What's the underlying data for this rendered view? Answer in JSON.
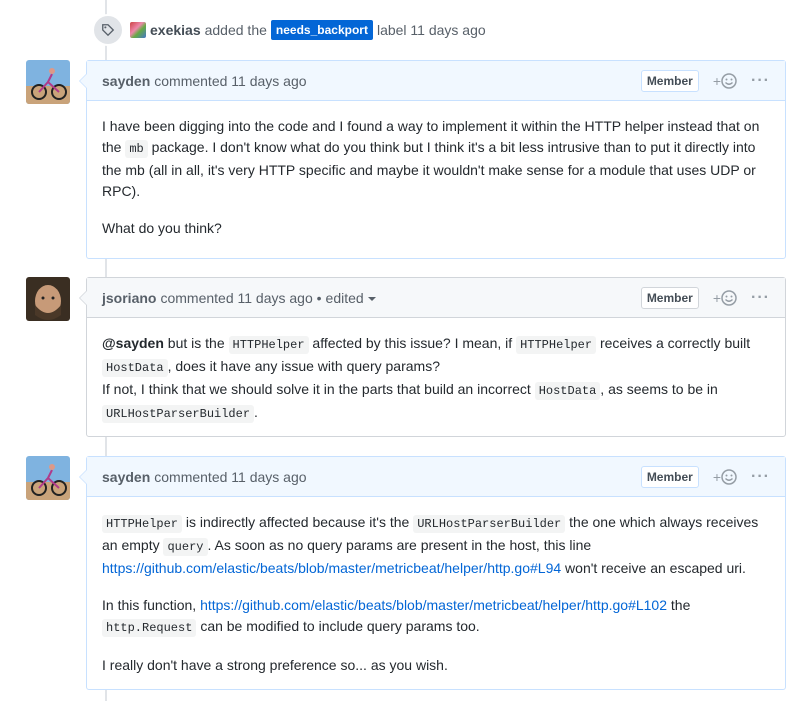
{
  "event": {
    "actor": "exekias",
    "text_before": "added the",
    "label": "needs_backport",
    "text_after": "label 11 days ago",
    "icon": "tag-icon"
  },
  "comments": [
    {
      "author": "sayden",
      "meta": "commented 11 days ago",
      "member": "Member",
      "react": "+",
      "body": {
        "p1_a": "I have been digging into the code and I found a way to implement it within the HTTP helper instead that on the",
        "p1_code": "mb",
        "p1_b": "package. I don't know what do you think but I think it's a bit less intrusive than to put it directly into the mb (all in all, it's very HTTP specific and maybe it wouldn't make sense for a module that uses UDP or RPC).",
        "p2": "What do you think?"
      }
    },
    {
      "author": "jsoriano",
      "meta": "commented 11 days ago •",
      "edited": "edited",
      "member": "Member",
      "react": "+",
      "body": {
        "mention": "@sayden",
        "t1": "but is the",
        "c1": "HTTPHelper",
        "t2": "affected by this issue? I mean, if",
        "c2": "HTTPHelper",
        "t3": "receives a correctly built",
        "c3": "HostData",
        "t4": ", does it have any issue with query params?",
        "t5": "If not, I think that we should solve it in the parts that build an incorrect",
        "c4": "HostData",
        "t6": ", as seems to be in",
        "c5": "URLHostParserBuilder",
        "t7": "."
      }
    },
    {
      "author": "sayden",
      "meta": "commented 11 days ago",
      "member": "Member",
      "react": "+",
      "body": {
        "c1": "HTTPHelper",
        "t1": "is indirectly affected because it's the",
        "c2": "URLHostParserBuilder",
        "t2": "the one which always receives an empty",
        "c3": "query",
        "t3": ". As soon as no query params are present in the host, this line",
        "link1": "https://github.com/elastic/beats/blob/master/metricbeat/helper/http.go#L94",
        "t4": "won't receive an escaped uri.",
        "t5": "In this function,",
        "link2": "https://github.com/elastic/beats/blob/master/metricbeat/helper/http.go#L102",
        "t6": "the",
        "c4": "http.Request",
        "t7": "can be modified to include query params too.",
        "p3": "I really don't have a strong preference so... as you wish."
      }
    }
  ],
  "colors": {
    "accent": "#0366d6",
    "header_bg_author": "#f1f8ff",
    "header_bg": "#f6f8fa"
  }
}
